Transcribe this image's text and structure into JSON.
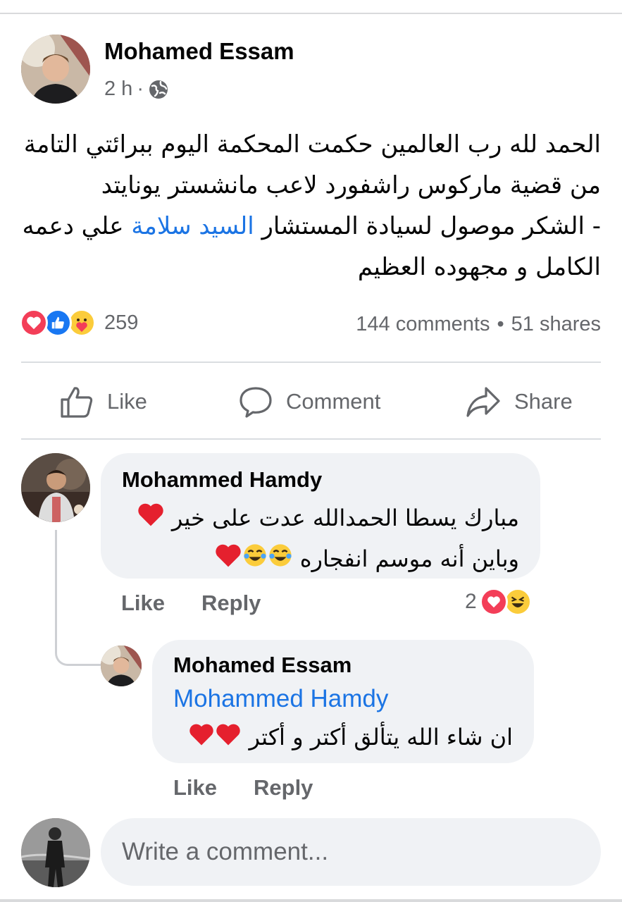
{
  "post": {
    "author": "Mohamed Essam",
    "time": "2 h",
    "separator": "·",
    "privacy_icon": "globe-icon",
    "text_lines": [
      "الحمد لله رب العالمين حكمت المحكمة اليوم ببرائتي التامة",
      "من قضية ماركوس راشفورد لاعب مانشستر يونايتد",
      "- الشكر موصول لسيادة المستشار",
      "علي دعمه",
      "الكامل و مجهوده العظيم"
    ],
    "mention": "السيد سلامة",
    "reaction_icons": [
      "heart-react-icon",
      "like-react-icon",
      "care-react-icon"
    ],
    "reaction_count": "259",
    "comments_count": "144 comments",
    "dot": "•",
    "shares_count": "51 shares"
  },
  "actions": {
    "like": "Like",
    "comment": "Comment",
    "share": "Share"
  },
  "comments": [
    {
      "author": "Mohammed Hamdy",
      "lines": [
        "مبارك يسطا الحمدالله عدت على خير",
        "وباين أنه موسم انفجاره"
      ],
      "like": "Like",
      "reply": "Reply",
      "reaction_count": "2",
      "reaction_icons": [
        "heart-react-icon",
        "haha-react-icon"
      ]
    },
    {
      "author": "Mohamed Essam",
      "mention": "Mohammed Hamdy",
      "lines": [
        "ان شاء الله يتألق أكتر و أكتر"
      ],
      "like": "Like",
      "reply": "Reply"
    }
  ],
  "composer": {
    "placeholder": "Write a comment..."
  },
  "colors": {
    "link": "#1b74e4",
    "muted": "#65676b",
    "bubble": "#f0f2f5",
    "love": "#f33e58",
    "like": "#1877f2",
    "emoji": "#fbcc3b"
  }
}
